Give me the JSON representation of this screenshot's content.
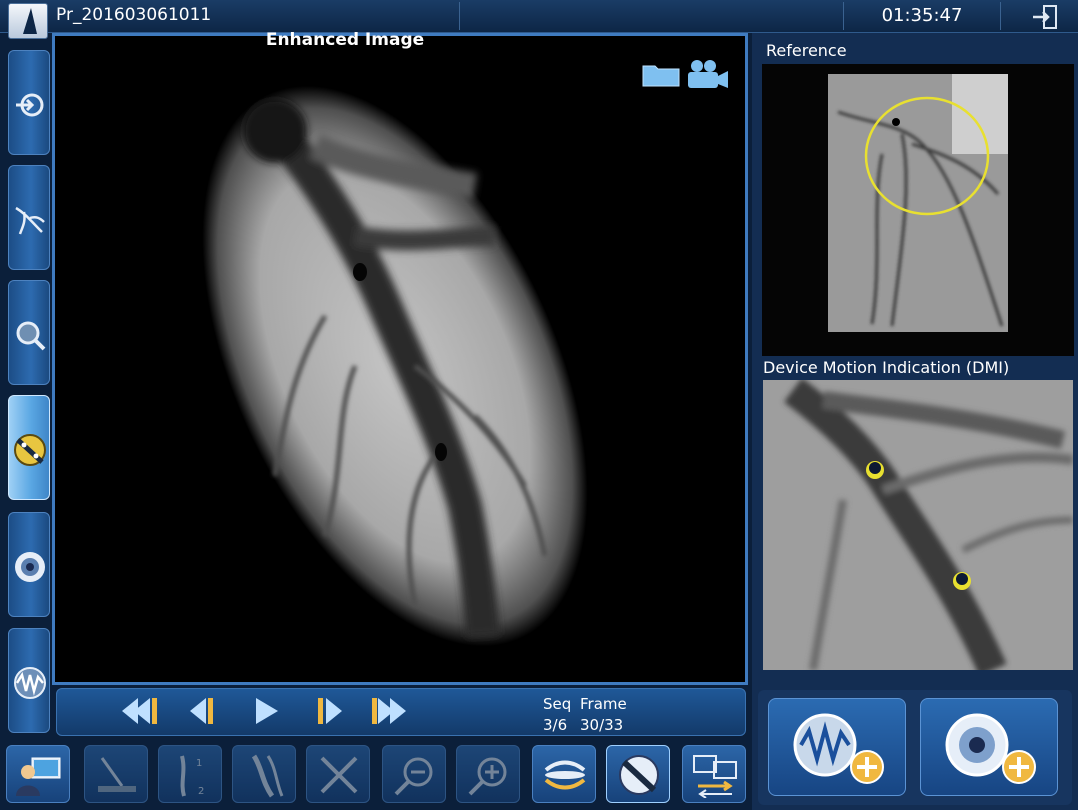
{
  "header": {
    "patient_id": "Pr_201603061011",
    "time": "01:35:47"
  },
  "viewer": {
    "title": "Enhanced Image",
    "seq_label": "Seq",
    "frame_label": "Frame",
    "seq_value": "3/6",
    "frame_value": "30/33"
  },
  "reference": {
    "title": "Reference"
  },
  "dmi": {
    "title": "Device Motion Indication (DMI)"
  },
  "icons": {
    "logo": "logo-icon",
    "exit": "exit-icon",
    "folder": "folder-icon",
    "camera": "video-camera-icon"
  },
  "sidebar": {
    "items": [
      {
        "name": "acquire-icon",
        "active": false
      },
      {
        "name": "vessel-tree-icon",
        "active": false
      },
      {
        "name": "vessel-zoom-icon",
        "active": false
      },
      {
        "name": "stent-boost-icon",
        "active": true
      },
      {
        "name": "ivus-icon",
        "active": false
      },
      {
        "name": "waveform-icon",
        "active": false
      }
    ]
  },
  "colors": {
    "accent": "#3f7bc0",
    "panel": "#132d52",
    "marker": "#e8e030"
  }
}
